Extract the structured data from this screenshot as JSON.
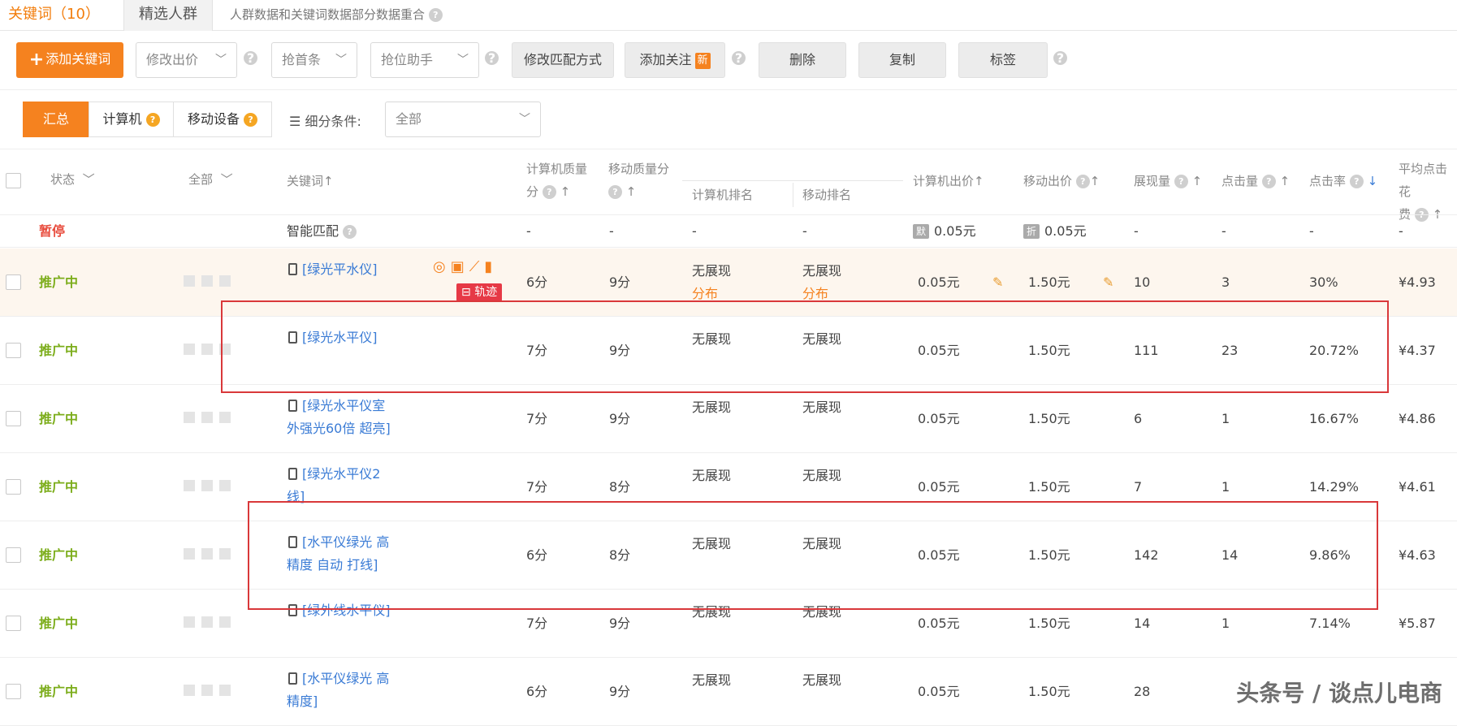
{
  "tabs": {
    "keywords": "关键词（10）",
    "crowd": "精选人群",
    "note": "人群数据和关键词数据部分数据重合"
  },
  "toolbar": {
    "add_keyword": "添加关键词",
    "modify_bid": "修改出价",
    "grab_top": "抢首条",
    "position_helper": "抢位助手",
    "modify_match": "修改匹配方式",
    "add_follow": "添加关注",
    "new_badge": "新",
    "delete": "删除",
    "copy": "复制",
    "tag": "标签"
  },
  "filters": {
    "summary": "汇总",
    "computer": "计算机",
    "mobile": "移动设备",
    "sub_condition_label": "细分条件:",
    "sub_condition_value": "全部"
  },
  "table": {
    "headers": {
      "status": "状态",
      "all": "全部",
      "keyword": "关键词",
      "pc_quality_1": "计算机质量",
      "pc_quality_2": "分",
      "mobile_quality": "移动质量分",
      "pc_rank": "计算机排名",
      "mobile_rank": "移动排名",
      "pc_bid": "计算机出价",
      "mobile_bid": "移动出价",
      "impressions": "展现量",
      "clicks": "点击量",
      "ctr": "点击率",
      "avg_cpc_1": "平均点击花",
      "avg_cpc_2": "费"
    },
    "smart_row": {
      "status": "暂停",
      "keyword": "智能匹配",
      "pc_quality": "-",
      "mobile_quality": "-",
      "pc_rank": "-",
      "mobile_rank": "-",
      "pc_bid_tag": "默",
      "pc_bid": "0.05元",
      "mobile_bid_tag": "折",
      "mobile_bid": "0.05元",
      "impressions": "-",
      "clicks": "-",
      "ctr": "-",
      "avg_cpc": "-"
    },
    "distribution": "分布",
    "track": "轨迹",
    "rows": [
      {
        "status": "推广中",
        "kw1": "[绿光平水仪]",
        "kw2": "",
        "pcq": "6分",
        "mq": "9分",
        "pcr": "无展现",
        "mr": "无展现",
        "pcb": "0.05元",
        "mb": "1.50元",
        "imp": "10",
        "clk": "3",
        "ctr": "30%",
        "cpc": "¥4.93"
      },
      {
        "status": "推广中",
        "kw1": "[绿光水平仪]",
        "kw2": "",
        "pcq": "7分",
        "mq": "9分",
        "pcr": "无展现",
        "mr": "无展现",
        "pcb": "0.05元",
        "mb": "1.50元",
        "imp": "111",
        "clk": "23",
        "ctr": "20.72%",
        "cpc": "¥4.37"
      },
      {
        "status": "推广中",
        "kw1": "[绿光水平仪室",
        "kw2": "外强光60倍 超亮]",
        "pcq": "7分",
        "mq": "9分",
        "pcr": "无展现",
        "mr": "无展现",
        "pcb": "0.05元",
        "mb": "1.50元",
        "imp": "6",
        "clk": "1",
        "ctr": "16.67%",
        "cpc": "¥4.86"
      },
      {
        "status": "推广中",
        "kw1": "[绿光水平仪2",
        "kw2": "线]",
        "pcq": "7分",
        "mq": "8分",
        "pcr": "无展现",
        "mr": "无展现",
        "pcb": "0.05元",
        "mb": "1.50元",
        "imp": "7",
        "clk": "1",
        "ctr": "14.29%",
        "cpc": "¥4.61"
      },
      {
        "status": "推广中",
        "kw1": "[水平仪绿光 高",
        "kw2": "精度 自动 打线]",
        "pcq": "6分",
        "mq": "8分",
        "pcr": "无展现",
        "mr": "无展现",
        "pcb": "0.05元",
        "mb": "1.50元",
        "imp": "142",
        "clk": "14",
        "ctr": "9.86%",
        "cpc": "¥4.63"
      },
      {
        "status": "推广中",
        "kw1": "[绿外线水平仪]",
        "kw2": "",
        "pcq": "7分",
        "mq": "9分",
        "pcr": "无展现",
        "mr": "无展现",
        "pcb": "0.05元",
        "mb": "1.50元",
        "imp": "14",
        "clk": "1",
        "ctr": "7.14%",
        "cpc": "¥5.87"
      },
      {
        "status": "推广中",
        "kw1": "[水平仪绿光 高",
        "kw2": "精度]",
        "pcq": "6分",
        "mq": "9分",
        "pcr": "无展现",
        "mr": "无展现",
        "pcb": "0.05元",
        "mb": "1.50元",
        "imp": "28",
        "clk": "",
        "ctr": "",
        "cpc": ""
      }
    ]
  },
  "watermark": "头条号 / 谈点儿电商"
}
